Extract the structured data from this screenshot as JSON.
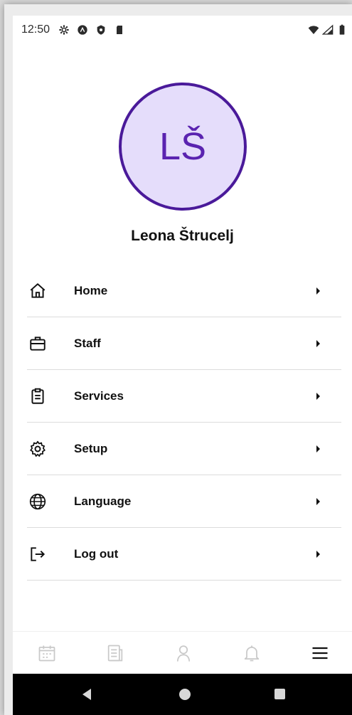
{
  "status_bar": {
    "time": "12:50",
    "left_icons": [
      "gear-icon",
      "android-icon",
      "shield-icon",
      "sdcard-icon"
    ],
    "right_icons": [
      "wifi-icon",
      "signal-icon",
      "battery-icon"
    ]
  },
  "profile": {
    "initials": "LŠ",
    "name": "Leona Štrucelj",
    "avatar_bg": "#e5ddfb",
    "avatar_border": "#4a1a9a",
    "avatar_text_color": "#5a23b0"
  },
  "menu": {
    "items": [
      {
        "label": "Home",
        "icon": "home-icon"
      },
      {
        "label": "Staff",
        "icon": "briefcase-icon"
      },
      {
        "label": "Services",
        "icon": "clipboard-icon"
      },
      {
        "label": "Setup",
        "icon": "gear-icon"
      },
      {
        "label": "Language",
        "icon": "globe-icon"
      },
      {
        "label": "Log out",
        "icon": "logout-icon"
      }
    ]
  },
  "bottom_nav": {
    "items": [
      {
        "icon": "calendar-icon",
        "active": false
      },
      {
        "icon": "document-icon",
        "active": false
      },
      {
        "icon": "person-icon",
        "active": false
      },
      {
        "icon": "bell-icon",
        "active": false
      },
      {
        "icon": "menu-icon",
        "active": true
      }
    ]
  },
  "system_nav": {
    "buttons": [
      "back-button",
      "home-button",
      "recents-button"
    ]
  }
}
